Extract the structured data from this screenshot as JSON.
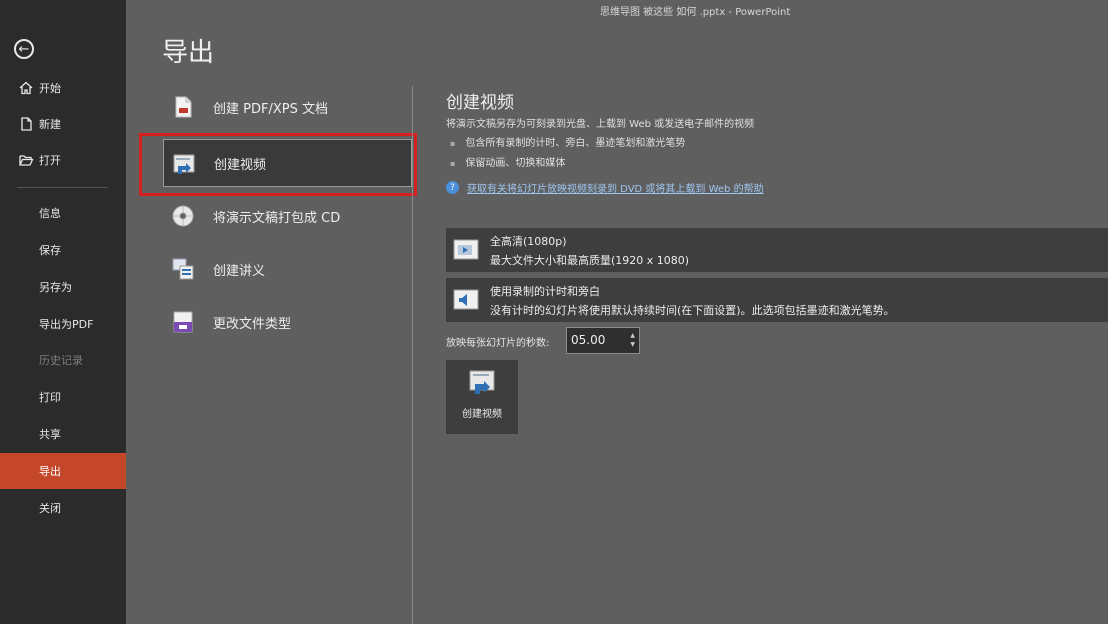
{
  "window": {
    "title": "思维导图 被这些 如何 .pptx  -  PowerPoint"
  },
  "sidebar": {
    "back_label": "←",
    "items": [
      {
        "label": "开始",
        "icon": "home-icon"
      },
      {
        "label": "新建",
        "icon": "new-file-icon"
      },
      {
        "label": "打开",
        "icon": "folder-open-icon"
      },
      {
        "label": "信息"
      },
      {
        "label": "保存"
      },
      {
        "label": "另存为"
      },
      {
        "label": "导出为PDF"
      },
      {
        "label": "历史记录",
        "disabled": true
      },
      {
        "label": "打印"
      },
      {
        "label": "共享"
      },
      {
        "label": "导出",
        "active": true
      },
      {
        "label": "关闭"
      }
    ]
  },
  "page_title": "导出",
  "export_options": [
    {
      "label": "创建 PDF/XPS 文档",
      "icon": "pdf-document-icon"
    },
    {
      "label": "创建视频",
      "icon": "video-icon",
      "selected": true
    },
    {
      "label": "将演示文稿打包成 CD",
      "icon": "cd-icon"
    },
    {
      "label": "创建讲义",
      "icon": "handout-icon"
    },
    {
      "label": "更改文件类型",
      "icon": "file-type-icon"
    }
  ],
  "video_panel": {
    "title": "创建视频",
    "description": "将演示文稿另存为可刻录到光盘、上载到 Web 或发送电子邮件的视频",
    "bullets": [
      "包含所有录制的计时、旁白、墨迹笔划和激光笔势",
      "保留动画、切换和媒体"
    ],
    "help_link": "获取有关将幻灯片放映视频刻录到 DVD 或将其上载到 Web 的帮助",
    "quality": {
      "title": "全高清(1080p)",
      "subtitle": "最大文件大小和最高质量(1920 x 1080)"
    },
    "timings": {
      "title": "使用录制的计时和旁白",
      "subtitle": "没有计时的幻灯片将使用默认持续时间(在下面设置)。此选项包括墨迹和激光笔势。"
    },
    "seconds_label": "放映每张幻灯片的秒数:",
    "seconds_value": "05.00",
    "create_button": "创建视频"
  },
  "colors": {
    "sidebar_bg": "#2b2b2b",
    "content_bg": "#5f5f5f",
    "active_nav": "#c4472a",
    "highlight_border": "#d42020",
    "link": "#9fc6f2"
  }
}
